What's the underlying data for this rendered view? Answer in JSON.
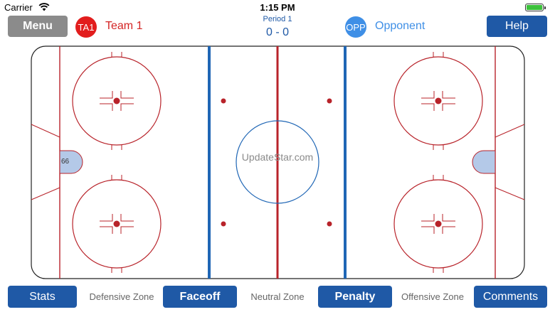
{
  "status_bar": {
    "carrier": "Carrier",
    "time": "1:15 PM"
  },
  "header": {
    "menu_label": "Menu",
    "help_label": "Help",
    "team": {
      "badge": "TA1",
      "name": "Team 1"
    },
    "opponent": {
      "badge": "OPP",
      "name": "Opponent"
    },
    "period": "Period 1",
    "score": "0 - 0"
  },
  "rink": {
    "watermark": "UpdateStar.com",
    "goalie_number": "66"
  },
  "footer": {
    "stats_label": "Stats",
    "defensive_zone": "Defensive Zone",
    "faceoff_label": "Faceoff",
    "neutral_zone": "Neutral Zone",
    "penalty_label": "Penalty",
    "offensive_zone": "Offensive Zone",
    "comments_label": "Comments"
  },
  "colors": {
    "accent_blue": "#1f59a6",
    "team_red": "#e21d1d",
    "opponent_blue": "#3f8fe6",
    "rink_red": "#b8232a",
    "rink_blue": "#1f66b5"
  },
  "icons": [
    "wifi-icon",
    "battery-icon"
  ]
}
